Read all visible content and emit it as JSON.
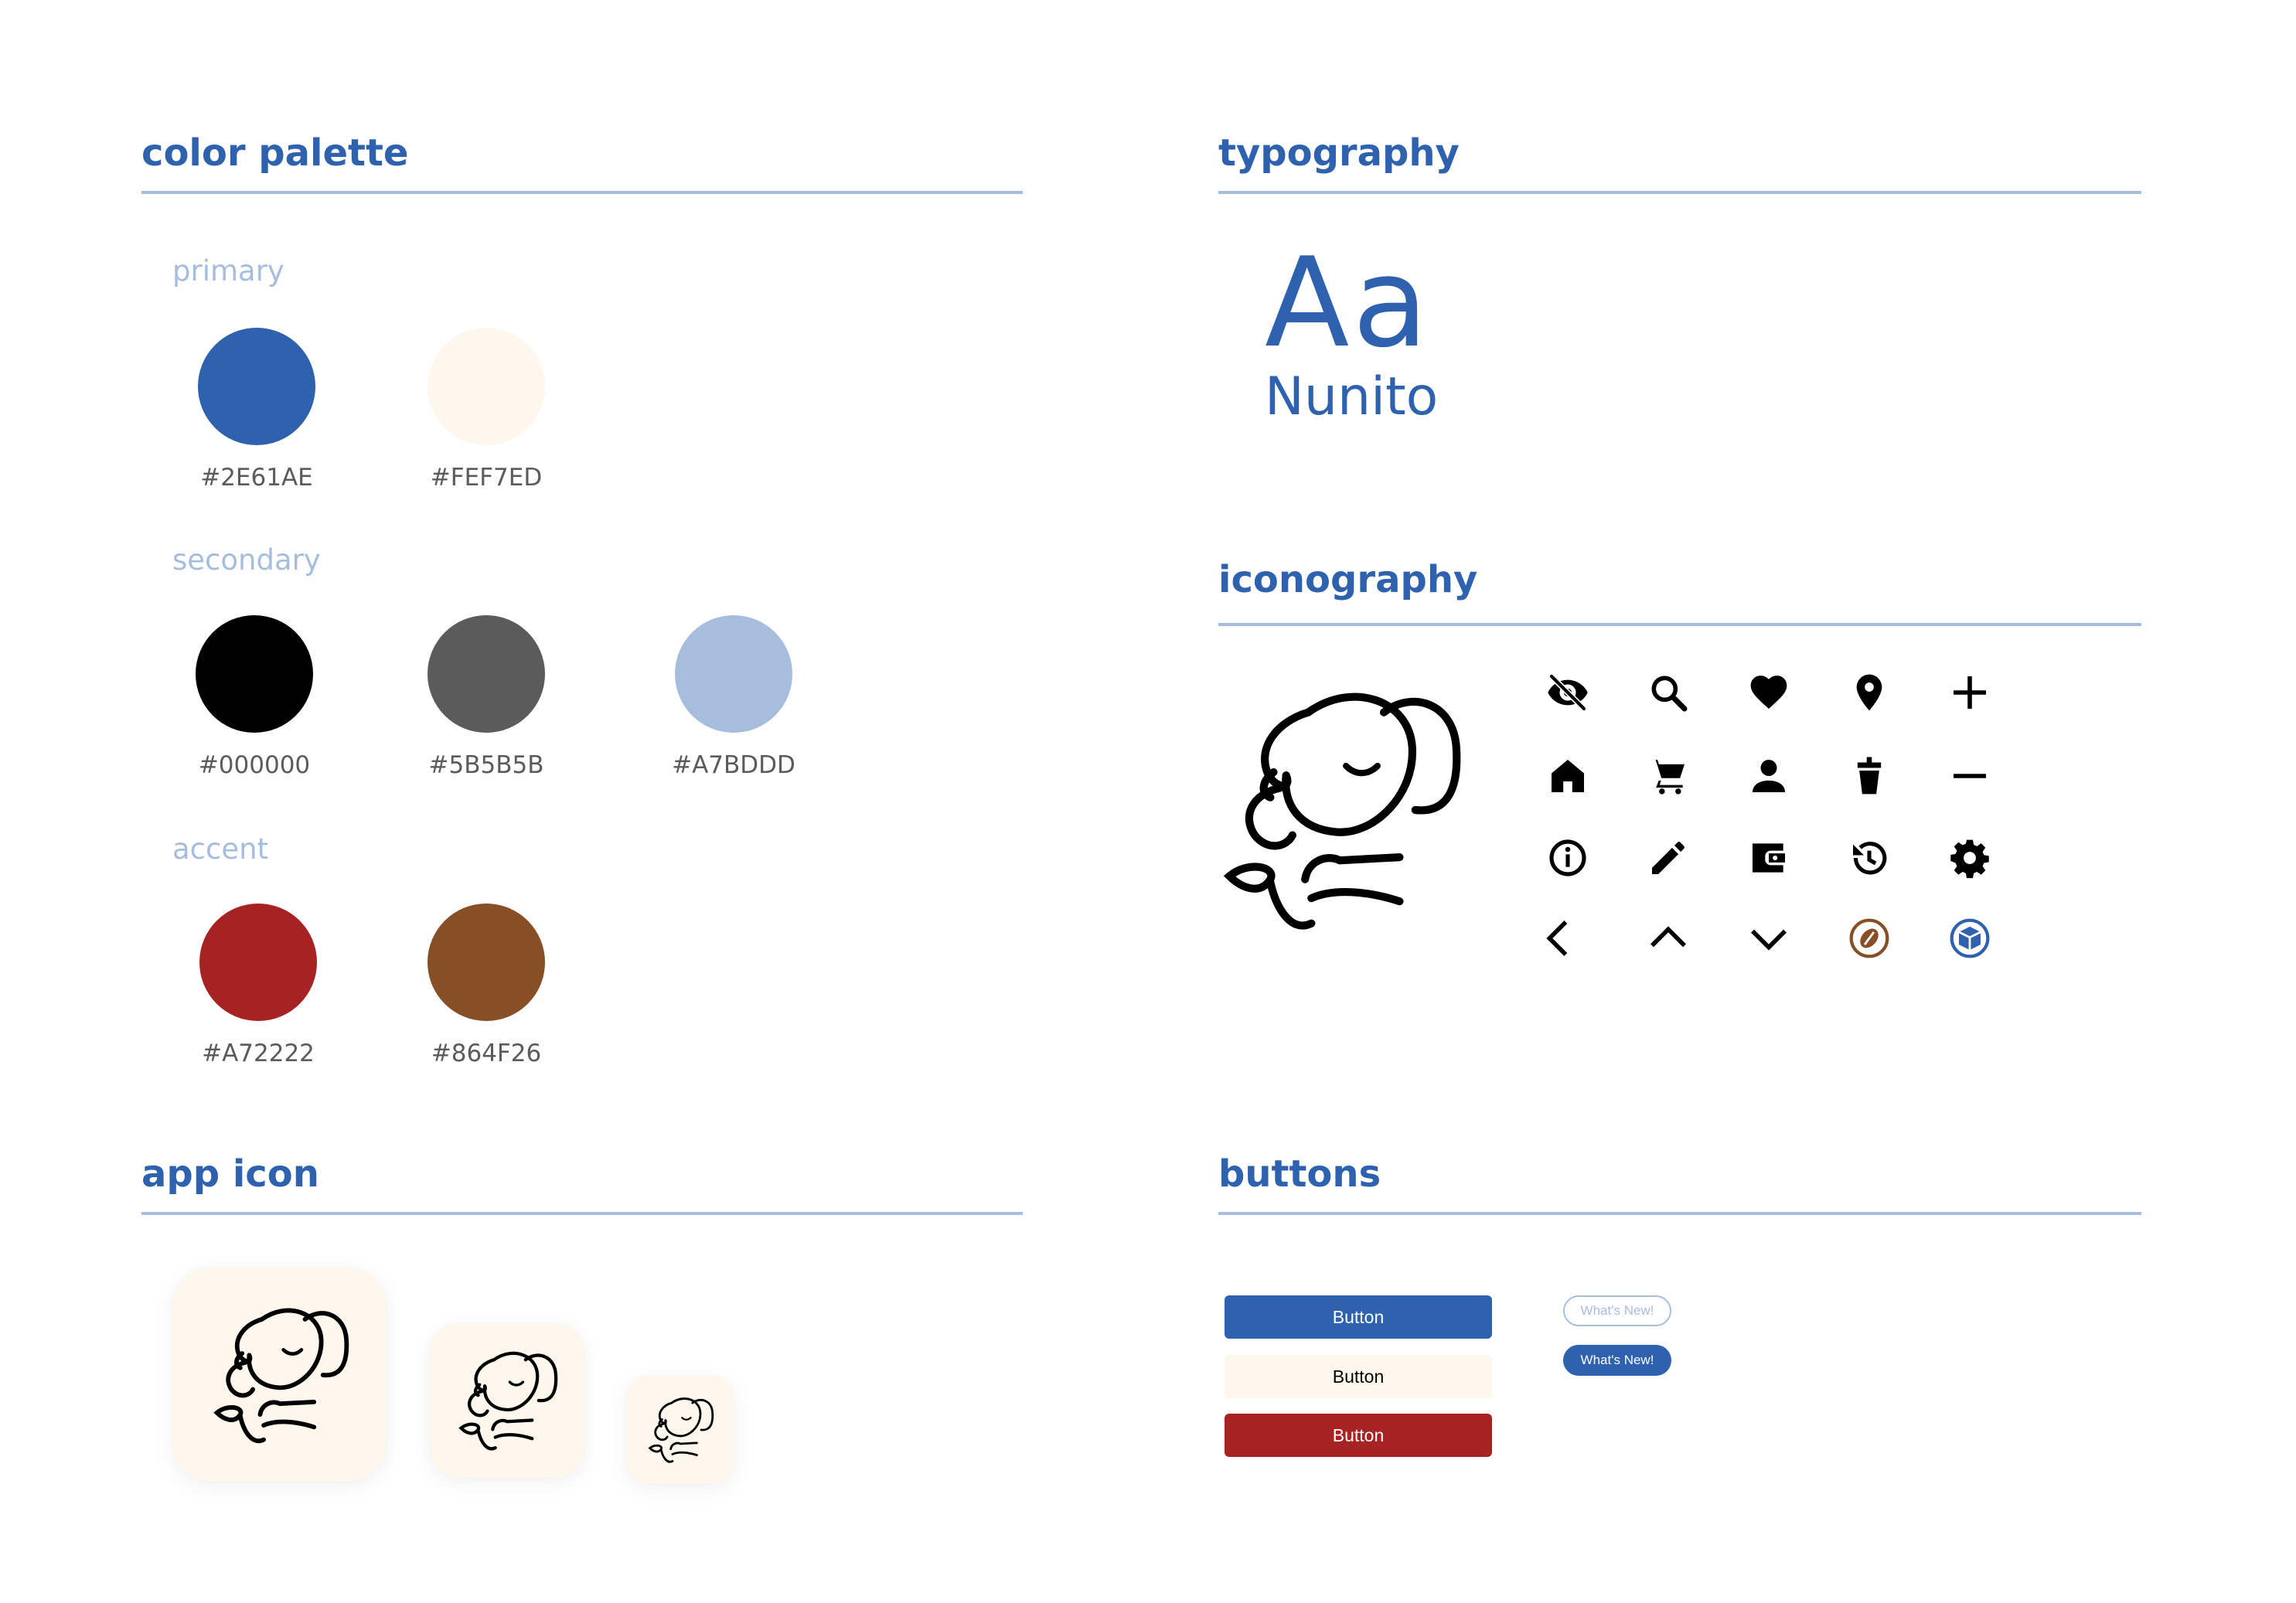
{
  "sections": {
    "color_palette": "color palette",
    "typography": "typography",
    "iconography": "iconography",
    "app_icon": "app icon",
    "buttons": "buttons"
  },
  "palette": {
    "primary": {
      "label": "primary",
      "swatches": [
        {
          "hex": "#2E61AE",
          "color": "#2E61AE"
        },
        {
          "hex": "#FEF7ED",
          "color": "#FEF7ED"
        }
      ]
    },
    "secondary": {
      "label": "secondary",
      "swatches": [
        {
          "hex": "#000000",
          "color": "#000000"
        },
        {
          "hex": "#5B5B5B",
          "color": "#5B5B5B"
        },
        {
          "hex": "#A7BDDD",
          "color": "#A7BDDD"
        }
      ]
    },
    "accent": {
      "label": "accent",
      "swatches": [
        {
          "hex": "#A72222",
          "color": "#A72222"
        },
        {
          "hex": "#864F26",
          "color": "#864F26"
        }
      ]
    }
  },
  "typography": {
    "sample": "Aa",
    "font_name": "Nunito"
  },
  "icons": [
    "eye-off-icon",
    "search-icon",
    "heart-icon",
    "location-pin-icon",
    "plus-icon",
    "home-icon",
    "cart-icon",
    "person-icon",
    "cup-icon",
    "minus-icon",
    "info-icon",
    "pencil-icon",
    "wallet-icon",
    "history-icon",
    "settings-icon",
    "chevron-left-icon",
    "chevron-up-icon",
    "chevron-down-icon",
    "coffee-bean-icon",
    "sugar-cube-icon"
  ],
  "buttons": {
    "primary_label": "Button",
    "secondary_label": "Button",
    "accent_label": "Button",
    "pill_outline_label": "What's New!",
    "pill_filled_label": "What's New!"
  },
  "colors": {
    "primary_blue": "#2E61AE",
    "cream": "#FEF7ED",
    "light_blue": "#A7BDDD",
    "red": "#A72222",
    "brown": "#864F26",
    "gray": "#5B5B5B"
  }
}
